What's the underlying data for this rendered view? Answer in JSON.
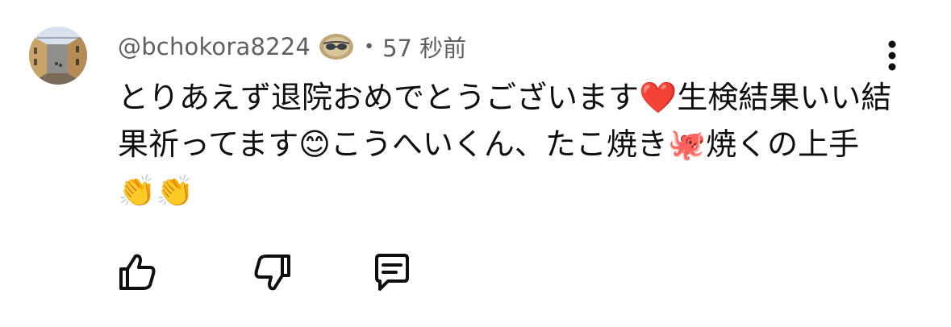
{
  "comment": {
    "author": {
      "handle": "@bchokora8224",
      "avatar_icon": "street-photo-avatar",
      "badge_icon": "sunglasses-badge-icon"
    },
    "separator": "•",
    "timestamp": "57 秒前",
    "body_text": "とりあえず退院おめでとうございます❤️生検結果いい結果祈ってます😊こうへいくん、たこ焼き🐙焼くの上手👏👏",
    "menu_icon": "more-vert-icon",
    "actions": {
      "like_icon": "thumbs-up-icon",
      "dislike_icon": "thumbs-down-icon",
      "reply_icon": "reply-comment-icon"
    }
  }
}
